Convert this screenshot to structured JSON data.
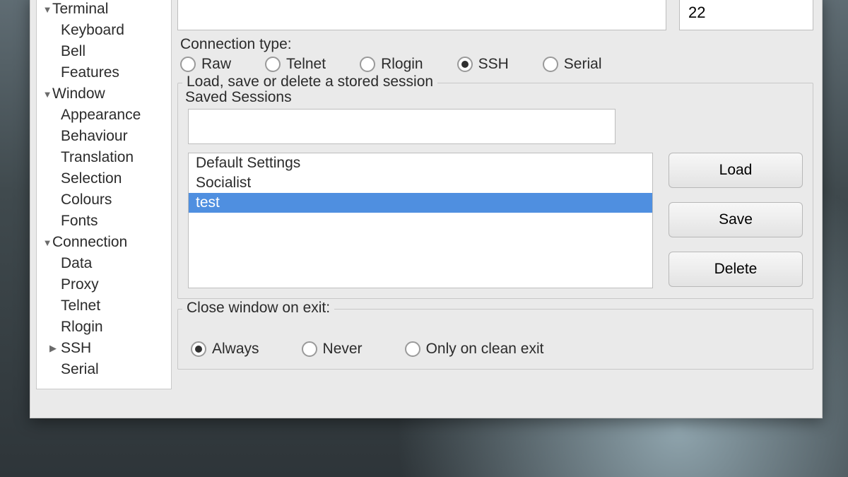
{
  "tree": {
    "terminal": {
      "label": "Terminal",
      "children": [
        "Keyboard",
        "Bell",
        "Features"
      ]
    },
    "window": {
      "label": "Window",
      "children": [
        "Appearance",
        "Behaviour",
        "Translation",
        "Selection",
        "Colours",
        "Fonts"
      ]
    },
    "connection": {
      "label": "Connection",
      "children": [
        "Data",
        "Proxy",
        "Telnet",
        "Rlogin",
        "SSH",
        "Serial"
      ]
    }
  },
  "port": "22",
  "conn_type": {
    "label": "Connection type:",
    "options": [
      "Raw",
      "Telnet",
      "Rlogin",
      "SSH",
      "Serial"
    ],
    "selected": "SSH"
  },
  "sessions": {
    "groupLabel": "Load, save or delete a stored session",
    "label": "Saved Sessions",
    "name_value": "",
    "items": [
      "Default Settings",
      "Socialist",
      "test"
    ],
    "selected": "test",
    "buttons": {
      "load": "Load",
      "save": "Save",
      "delete": "Delete"
    }
  },
  "close_exit": {
    "label": "Close window on exit:",
    "options": [
      "Always",
      "Never",
      "Only on clean exit"
    ],
    "selected": "Always"
  }
}
